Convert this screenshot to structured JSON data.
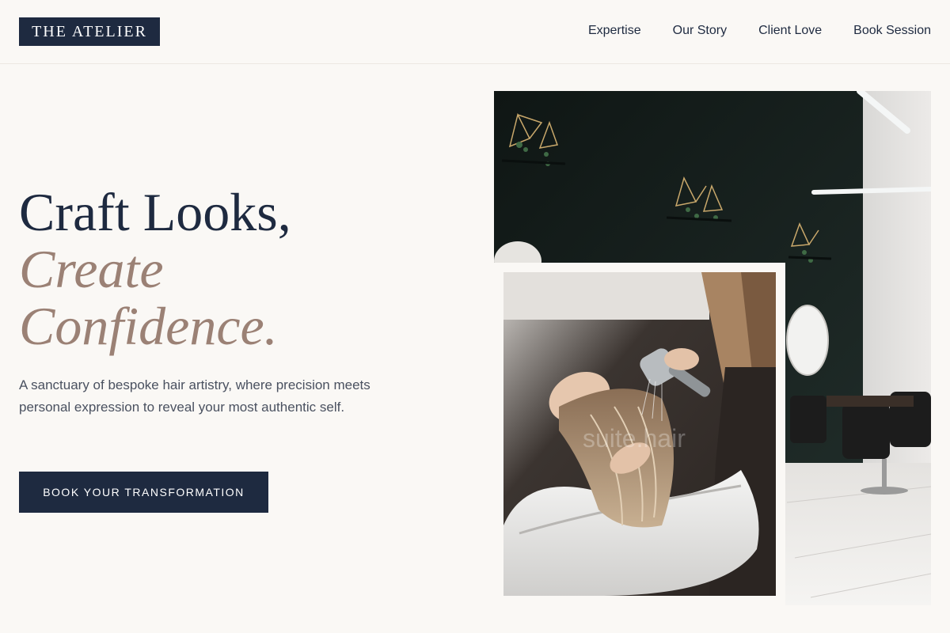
{
  "brand": {
    "logo_text": "THE ATELIER"
  },
  "nav": {
    "items": [
      {
        "label": "Expertise"
      },
      {
        "label": "Our Story"
      },
      {
        "label": "Client Love"
      },
      {
        "label": "Book Session"
      }
    ]
  },
  "hero": {
    "title_line1": "Craft Looks,",
    "title_line2": "Create",
    "title_line3": "Confidence.",
    "subtitle": "A sanctuary of bespoke hair artistry, where precision meets personal expression to reveal your most authentic self.",
    "cta_label": "BOOK YOUR TRANSFORMATION"
  },
  "images": {
    "back_photo": "salon-interior-photo",
    "front_photo": "hair-wash-photo",
    "watermark_text": "suite.hair"
  },
  "colors": {
    "navy": "#1e2a40",
    "accent_taupe": "#9b8175",
    "background": "#faf8f5"
  }
}
